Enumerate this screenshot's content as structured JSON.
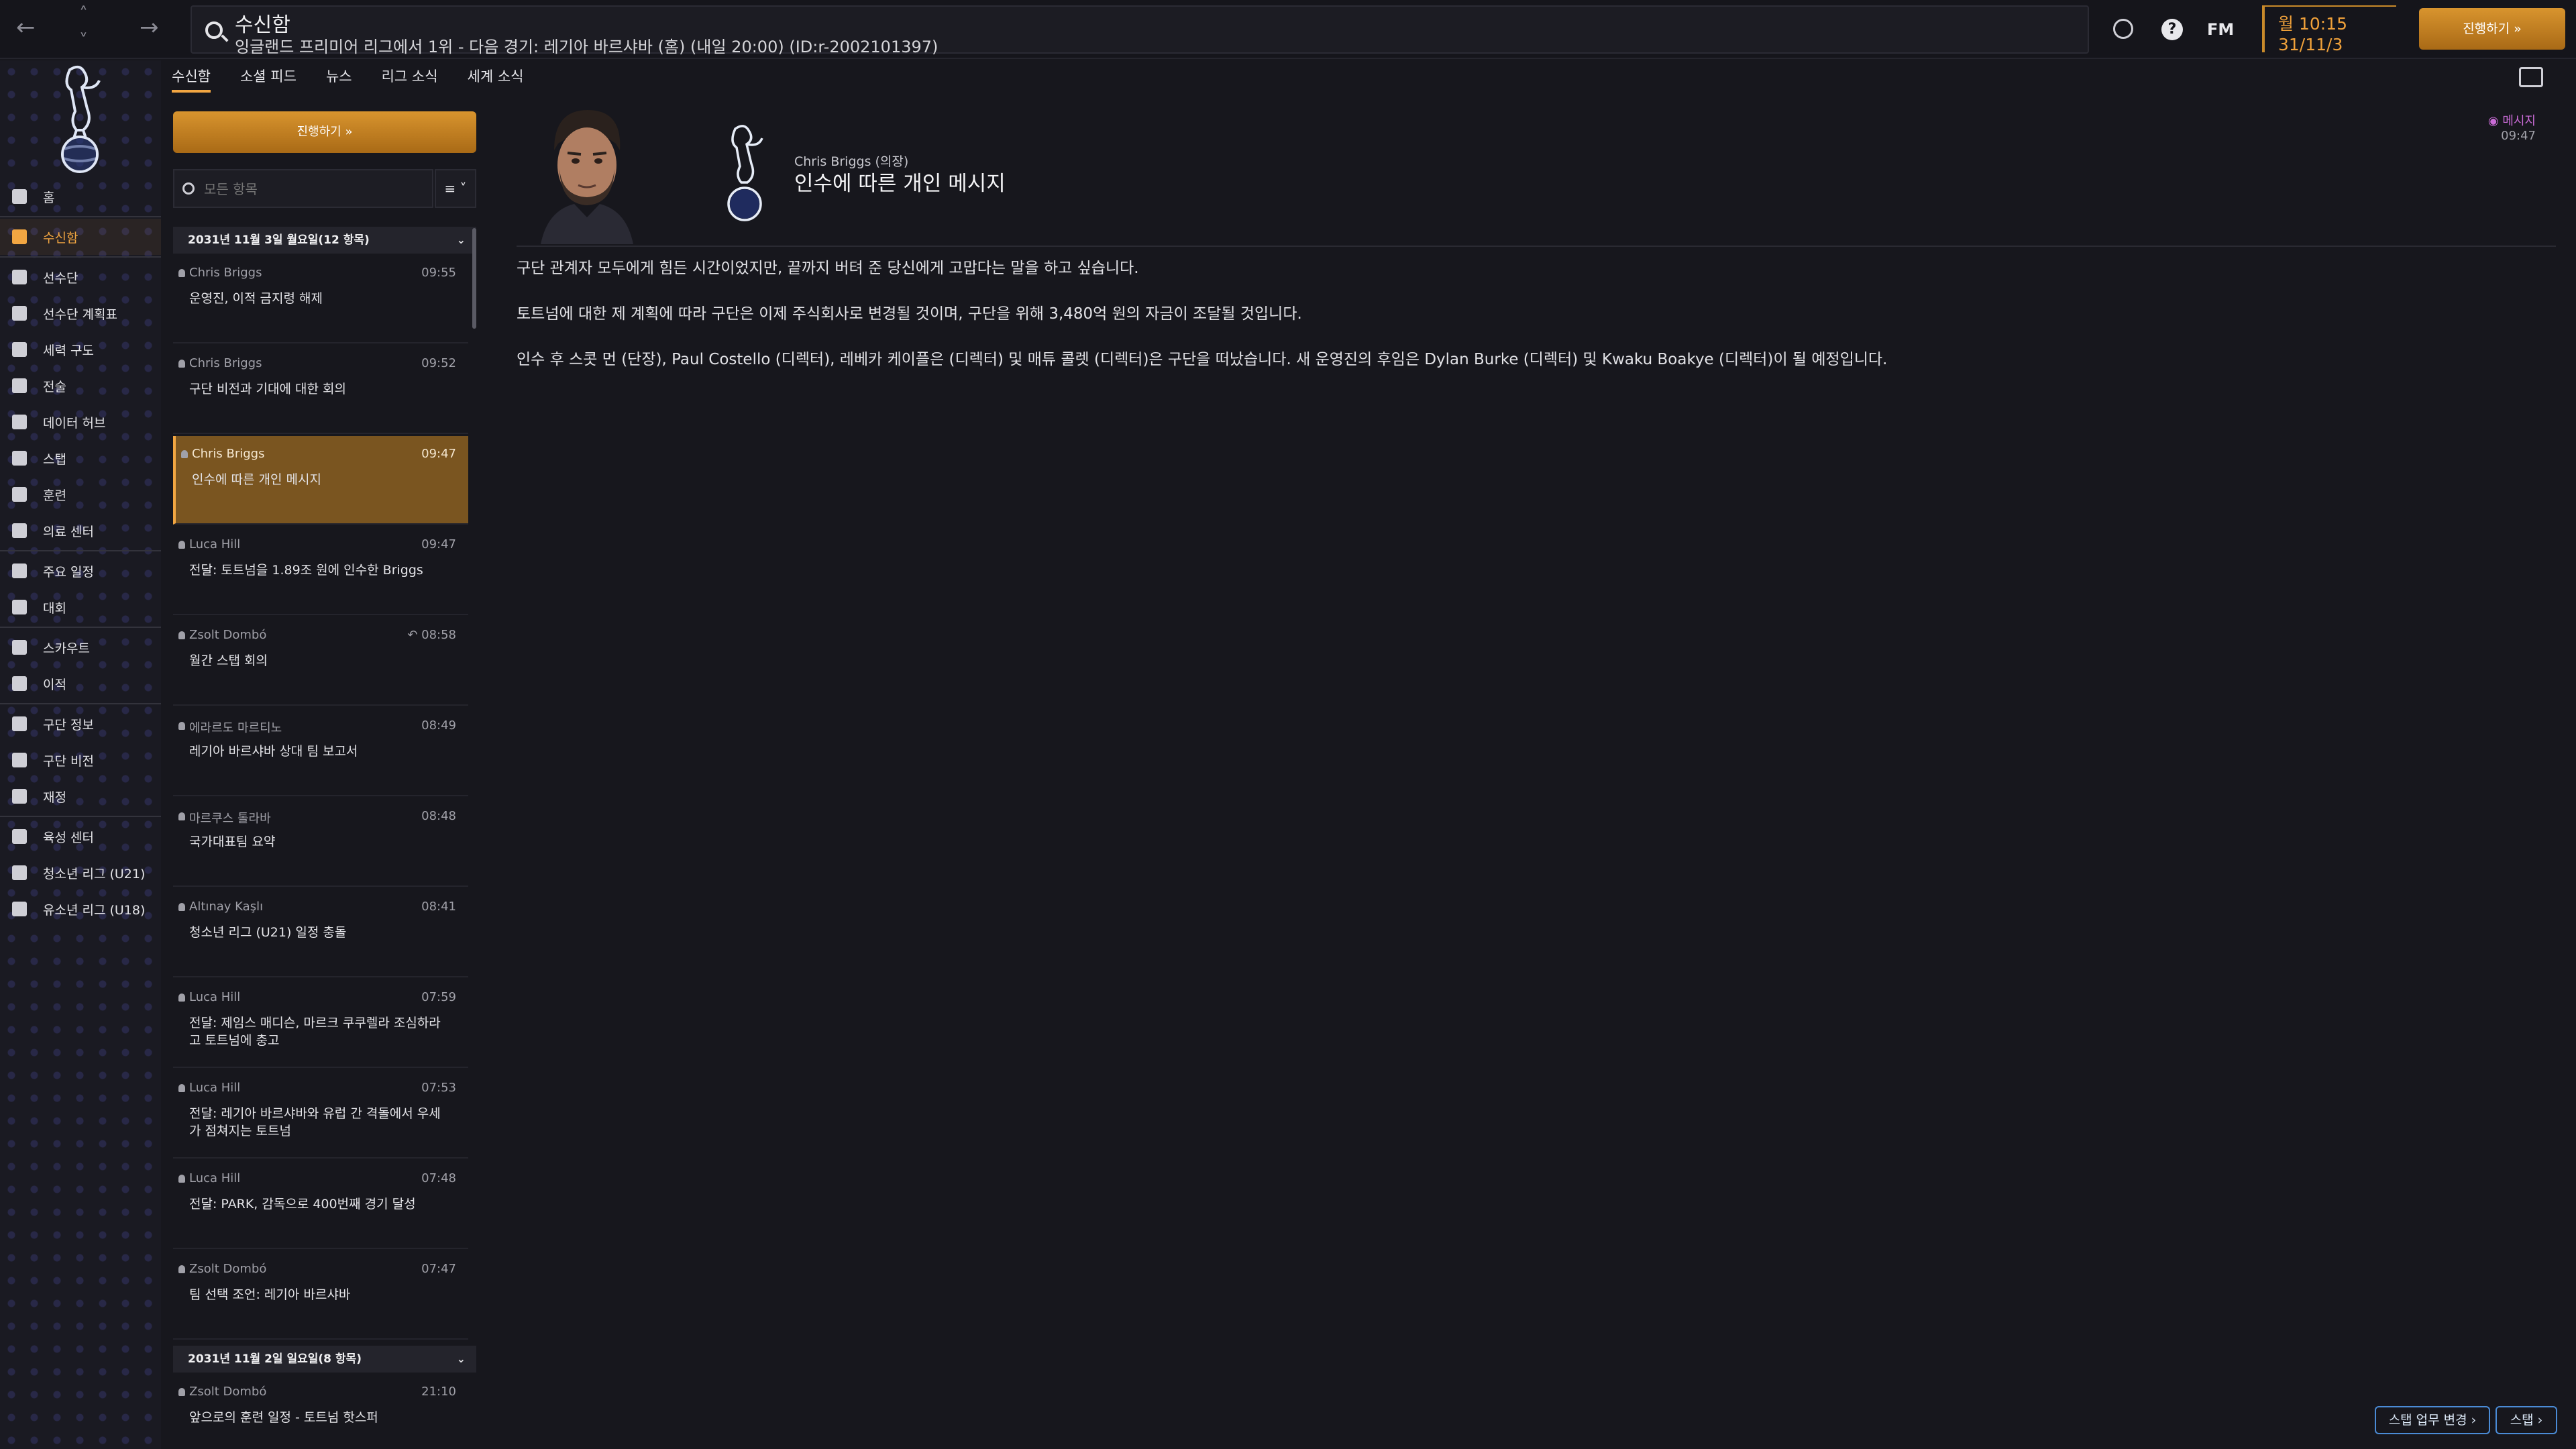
{
  "topbar": {
    "back": "←",
    "up": "˄",
    "down": "˅",
    "forward": "→",
    "search_title": "수신함",
    "search_sub": "잉글랜드 프리미어 리그에서 1위 - 다음 경기: 레기아 바르샤바 (홈) (내일 20:00) (ID:r-2002101397)",
    "help": "?",
    "fm": "FM",
    "time": "월 10:15",
    "date": "31/11/3",
    "continue": "진행하기 »"
  },
  "sidebar": {
    "items": [
      {
        "label": "홈"
      },
      {
        "label": "수신함"
      },
      {
        "label": "선수단"
      },
      {
        "label": "선수단 계획표"
      },
      {
        "label": "세력 구도"
      },
      {
        "label": "전술"
      },
      {
        "label": "데이터 허브"
      },
      {
        "label": "스탭"
      },
      {
        "label": "훈련"
      },
      {
        "label": "의료 센터"
      },
      {
        "label": "주요 일정"
      },
      {
        "label": "대회"
      },
      {
        "label": "스카우트"
      },
      {
        "label": "이적"
      },
      {
        "label": "구단 정보"
      },
      {
        "label": "구단 비전"
      },
      {
        "label": "재정"
      },
      {
        "label": "육성 센터"
      },
      {
        "label": "청소년 리그 (U21)"
      },
      {
        "label": "유소년 리그 (U18)"
      }
    ]
  },
  "tabs": [
    "수신함",
    "소셜 피드",
    "뉴스",
    "리그 소식",
    "세계 소식"
  ],
  "list": {
    "continue": "진행하기 »",
    "search_placeholder": "모든 항목",
    "filter": "≡ ˅",
    "group1": "2031년 11월 3일 월요일(12 항목)",
    "group2": "2031년 11월 2일 일요일(8 항목)",
    "chevron": "⌵",
    "messages": [
      {
        "from": "Chris Briggs",
        "time": "09:55",
        "subject": "운영진, 이적 금지령 해제"
      },
      {
        "from": "Chris Briggs",
        "time": "09:52",
        "subject": "구단 비전과 기대에 대한 회의"
      },
      {
        "from": "Chris Briggs",
        "time": "09:47",
        "subject": "인수에 따른 개인 메시지"
      },
      {
        "from": "Luca Hill",
        "time": "09:47",
        "subject": "전달: 토트넘을 1.89조 원에 인수한 Briggs"
      },
      {
        "from": "Zsolt Dombó",
        "time": "↶ 08:58",
        "subject": "월간 스탭 회의"
      },
      {
        "from": "에라르도 마르티노",
        "time": "08:49",
        "subject": "레기아 바르샤바 상대 팀 보고서"
      },
      {
        "from": "마르쿠스 톨라바",
        "time": "08:48",
        "subject": "국가대표팀 요약"
      },
      {
        "from": "Altınay Kaşlı",
        "time": "08:41",
        "subject": "청소년 리그 (U21) 일정 충돌"
      },
      {
        "from": "Luca Hill",
        "time": "07:59",
        "subject": "전달: 제임스 매디슨, 마르크 쿠쿠렐라 조심하라고 토트넘에 충고"
      },
      {
        "from": "Luca Hill",
        "time": "07:53",
        "subject": "전달: 레기아 바르샤바와 유럽 간 격돌에서 우세가 점쳐지는 토트넘"
      },
      {
        "from": "Luca Hill",
        "time": "07:48",
        "subject": "전달: PARK, 감독으로 400번째 경기 달성"
      },
      {
        "from": "Zsolt Dombó",
        "time": "07:47",
        "subject": "팀 선택 조언: 레기아 바르샤바"
      },
      {
        "from": "Zsolt Dombó",
        "time": "21:10",
        "subject": "앞으로의 훈련 일정 - 토트넘 핫스퍼"
      }
    ]
  },
  "view": {
    "sender": "Chris Briggs (의장)",
    "subject": "인수에 따른 개인 메시지",
    "tag": "메시지",
    "time": "09:47",
    "paragraphs": [
      "구단 관계자 모두에게 힘든 시간이었지만, 끝까지 버텨 준 당신에게 고맙다는 말을 하고 싶습니다.",
      "토트넘에 대한 제 계획에 따라 구단은 이제 주식회사로 변경될 것이며, 구단을 위해 3,480억 원의 자금이 조달될 것입니다.",
      "인수 후 스콧 먼 (단장), Paul Costello (디렉터), 레베카 케이플은 (디렉터) 및 매튜 콜렛 (디렉터)은 구단을 떠났습니다. 새 운영진의 후임은 Dylan Burke (디렉터) 및 Kwaku Boakye (디렉터)이 될 예정입니다."
    ]
  },
  "footer": {
    "staff_change": "스탭 업무 변경 ›",
    "staff": "스탭 ›"
  }
}
